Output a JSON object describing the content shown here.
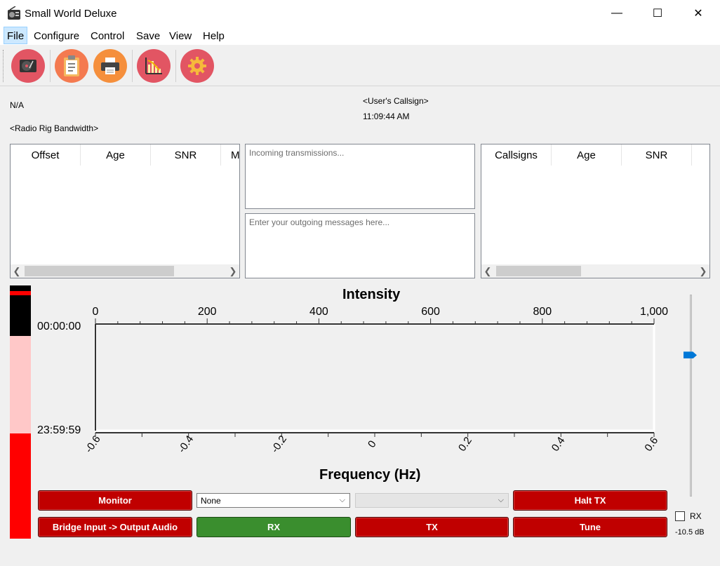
{
  "window": {
    "title": "Small World Deluxe",
    "minimize": "—",
    "maximize": "☐",
    "close": "✕"
  },
  "menu": [
    "File",
    "Configure",
    "Control",
    "Save",
    "View",
    "Help"
  ],
  "toolbar": {
    "icons": [
      "record-player-icon",
      "clipboard-icon",
      "printer-icon",
      "chart-icon",
      "settings-gear-icon"
    ],
    "colors": [
      "#e25563",
      "#f47a50",
      "#f58f3c",
      "#e25563",
      "#e25563"
    ]
  },
  "info": {
    "status": "N/A",
    "bandwidth": "<Radio Rig Bandwidth>",
    "callsign": "<User's Callsign>",
    "time": "11:09:44 AM"
  },
  "left_table": {
    "columns": [
      "Offset",
      "Age",
      "SNR",
      "M"
    ]
  },
  "right_table": {
    "columns": [
      "Callsigns",
      "Age",
      "SNR"
    ]
  },
  "messages": {
    "incoming_placeholder": "Incoming transmissions...",
    "outgoing_placeholder": "Enter your outgoing messages here..."
  },
  "waterfall": {
    "title": "Intensity",
    "x_label": "Frequency (Hz)",
    "top_ticks": [
      "0",
      "200",
      "400",
      "600",
      "800",
      "1,000"
    ],
    "bottom_ticks": [
      "-0.6",
      "-0.4",
      "-0.2",
      "0",
      "0.2",
      "0.4",
      "0.6"
    ],
    "time_start": "00:00:00",
    "time_end": "23:59:59"
  },
  "controls": {
    "monitor": "Monitor",
    "bridge": "Bridge Input -> Output Audio",
    "combo_selected": "None",
    "combo2_selected": "",
    "rx": "RX",
    "tx": "TX",
    "halt_tx": "Halt TX",
    "tune": "Tune"
  },
  "gain": {
    "checkbox_label": "RX",
    "db_value": "-10.5 dB",
    "level_fraction": 0.3
  },
  "colors": {
    "button_red": "#c00000",
    "button_green": "#3a8e2e",
    "meter_red": "#ff0000",
    "meter_pink": "#ffc8c8",
    "slider_blue": "#0078d7"
  }
}
